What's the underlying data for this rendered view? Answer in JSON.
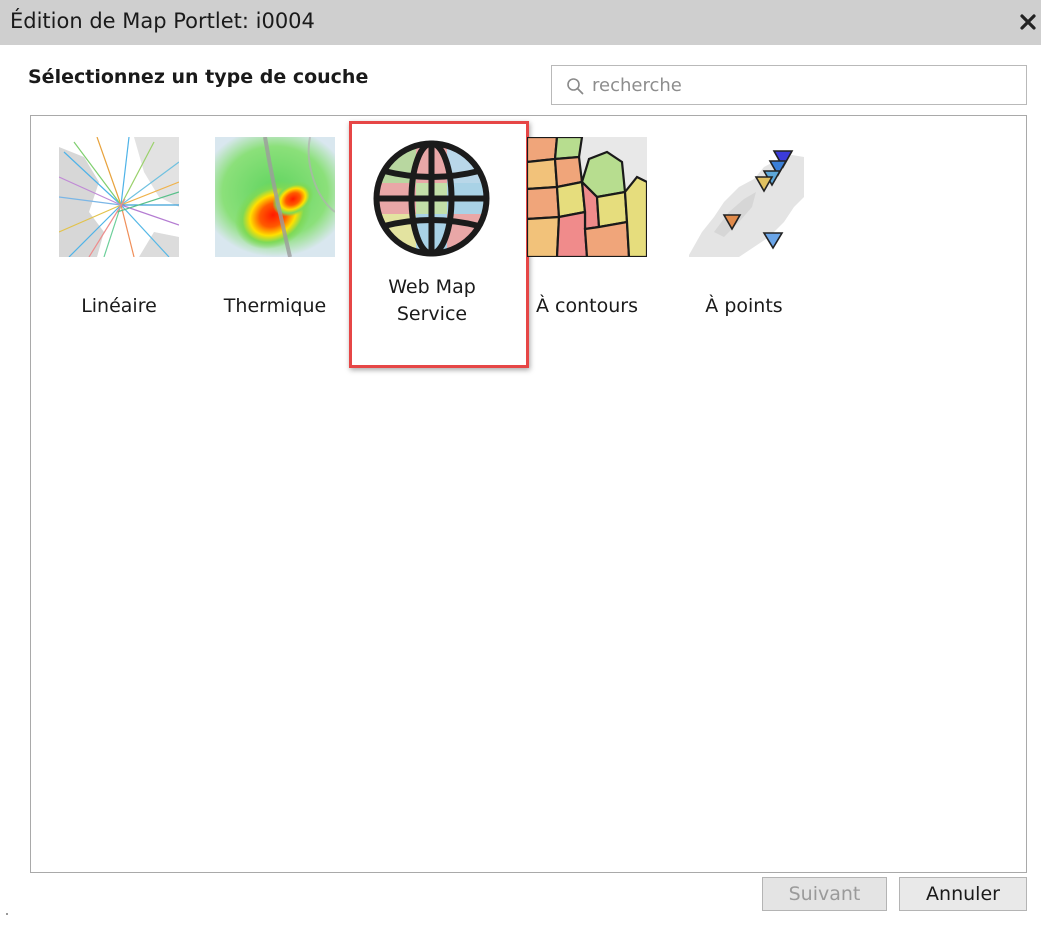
{
  "dialog": {
    "title": "Édition de Map Portlet: i0004",
    "heading": "Sélectionnez un type de couche",
    "search": {
      "placeholder": "recherche",
      "value": ""
    },
    "close_icon": "close-icon",
    "layer_types": [
      {
        "label": "Linéaire",
        "icon": "linear-map-thumbnail"
      },
      {
        "label": "Thermique",
        "icon": "heatmap-thumbnail"
      },
      {
        "label": "Web Map Service",
        "icon": "globe-icon",
        "selected": true,
        "highlight_color": "#e64646"
      },
      {
        "label": "À contours",
        "icon": "choropleth-map-thumbnail"
      },
      {
        "label": "À points",
        "icon": "point-map-thumbnail"
      }
    ],
    "buttons": {
      "next": {
        "label": "Suivant",
        "enabled": false
      },
      "cancel": {
        "label": "Annuler",
        "enabled": true
      }
    }
  }
}
